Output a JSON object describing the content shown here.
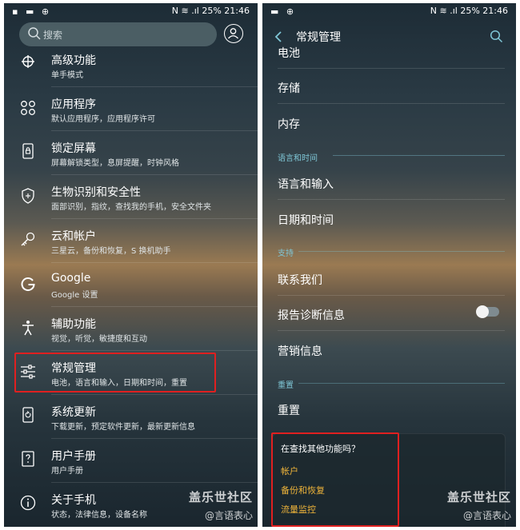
{
  "left": {
    "status": {
      "left_icons": "▪ ▬ ⊕",
      "right": "N ≋ .ıl 25% 21:46"
    },
    "search": {
      "placeholder": "搜索"
    },
    "items": [
      {
        "title": "高级功能",
        "sub": "单手模式",
        "icon": "advanced-features-icon"
      },
      {
        "title": "应用程序",
        "sub": "默认应用程序，应用程序许可",
        "icon": "apps-icon"
      },
      {
        "title": "锁定屏幕",
        "sub": "屏幕解锁类型，息屏提醒，时钟风格",
        "icon": "lock-screen-icon"
      },
      {
        "title": "生物识别和安全性",
        "sub": "面部识别，指纹，查找我的手机，安全文件夹",
        "icon": "shield-icon"
      },
      {
        "title": "云和帐户",
        "sub": "三星云，备份和恢复，S 换机助手",
        "icon": "key-icon"
      },
      {
        "title": "Google",
        "sub": "Google 设置",
        "icon": "google-icon"
      },
      {
        "title": "辅助功能",
        "sub": "视觉，听觉，敏捷度和互动",
        "icon": "accessibility-icon"
      },
      {
        "title": "常规管理",
        "sub": "电池，语言和输入，日期和时间，重置",
        "icon": "sliders-icon"
      },
      {
        "title": "系统更新",
        "sub": "下载更新，预定软件更新，最新更新信息",
        "icon": "system-update-icon"
      },
      {
        "title": "用户手册",
        "sub": "用户手册",
        "icon": "manual-icon"
      },
      {
        "title": "关于手机",
        "sub": "状态，法律信息，设备名称",
        "icon": "info-icon"
      }
    ],
    "watermark": {
      "line1": "盖乐世社区",
      "line2": "@言语表心"
    }
  },
  "right": {
    "status": {
      "left_icons": "▬ ⊕",
      "right": "N ≋ .ıl 25% 21:46"
    },
    "header": {
      "title": "常规管理"
    },
    "items": {
      "battery": "电池",
      "storage": "存储",
      "memory": "内存",
      "section_language": "语言和时间",
      "language_input": "语言和输入",
      "date_time": "日期和时间",
      "section_support": "支持",
      "contact_us": "联系我们",
      "diagnostics": "报告诊断信息",
      "marketing": "营销信息",
      "section_reset": "重置",
      "reset": "重置"
    },
    "diagnostics_toggle": false,
    "card": {
      "title": "在查找其他功能吗？",
      "links": [
        "帐户",
        "备份和恢复",
        "流量监控"
      ]
    },
    "watermark": {
      "line1": "盖乐世社区",
      "line2": "@言语表心"
    }
  },
  "colors": {
    "highlight": "#e02020",
    "link": "#f0b53a",
    "section": "#7fc6d6"
  }
}
